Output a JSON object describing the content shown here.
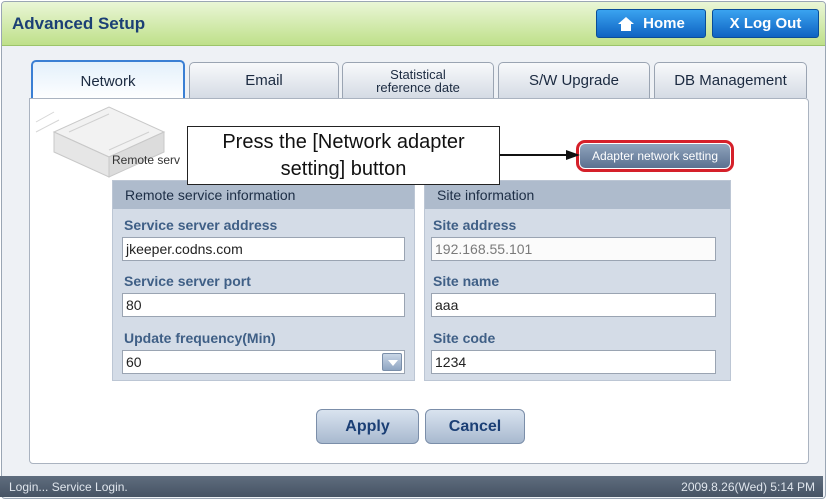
{
  "header": {
    "title": "Advanced Setup",
    "home_label": "Home",
    "logout_label": "X Log Out"
  },
  "tabs": [
    {
      "label": "Network",
      "active": true
    },
    {
      "label": "Email"
    },
    {
      "label_line1": "Statistical",
      "label_line2": "reference date"
    },
    {
      "label": "S/W Upgrade"
    },
    {
      "label": "DB Management"
    }
  ],
  "remote_service_label": "Remote serv",
  "adapter_button": "Adapter network setting",
  "callout": {
    "line1": "Press the [Network adapter",
    "line2": "setting] button"
  },
  "left_section": {
    "title": "Remote service information",
    "server_address_label": "Service server address",
    "server_address_value": "jkeeper.codns.com",
    "server_port_label": "Service server port",
    "server_port_value": "80",
    "update_frequency_label": "Update frequency(Min)",
    "update_frequency_value": "60"
  },
  "right_section": {
    "title": "Site information",
    "site_address_label": "Site address",
    "site_address_value": "192.168.55.101",
    "site_name_label": "Site name",
    "site_name_value": "aaa",
    "site_code_label": "Site code",
    "site_code_value": "1234"
  },
  "actions": {
    "apply": "Apply",
    "cancel": "Cancel"
  },
  "status": {
    "left": "Login... Service Login.",
    "right": "2009.8.26(Wed)  5:14 PM"
  }
}
